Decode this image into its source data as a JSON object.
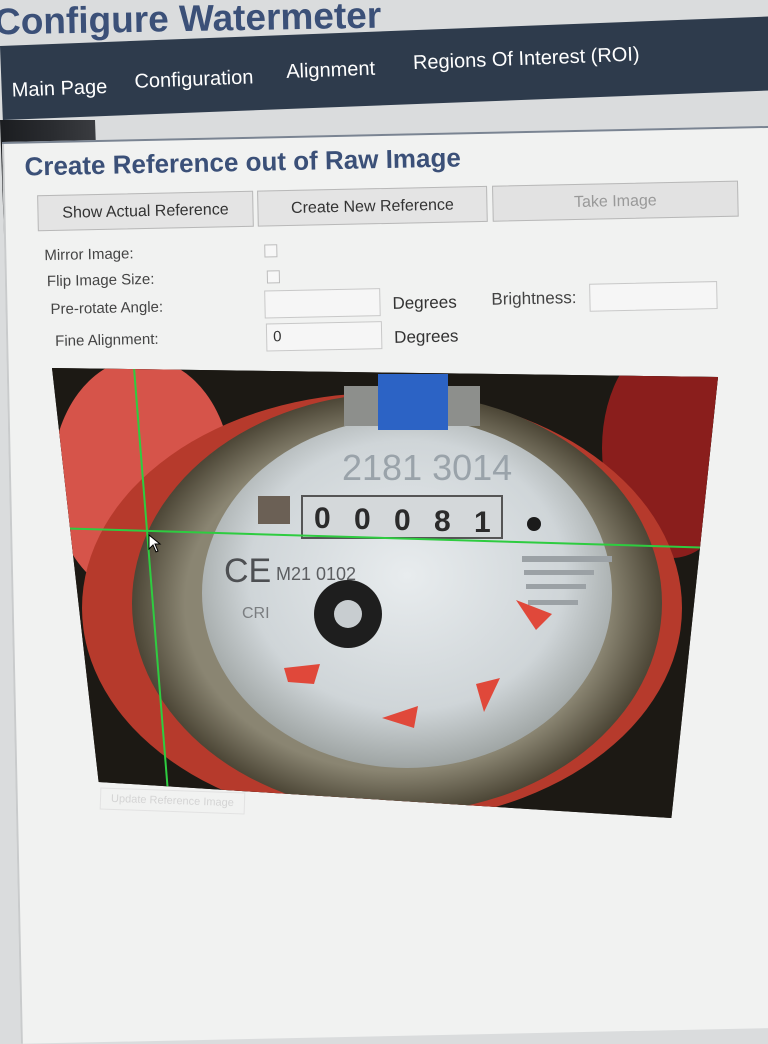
{
  "app": {
    "title": "Configure Watermeter"
  },
  "nav": {
    "items": [
      {
        "label": "Main Page"
      },
      {
        "label": "Configuration"
      },
      {
        "label": "Alignment"
      },
      {
        "label": "Regions Of Interest (ROI)"
      }
    ]
  },
  "section": {
    "heading": "Create Reference out of Raw Image"
  },
  "buttons": {
    "show_actual": "Show Actual Reference",
    "create_new": "Create New Reference",
    "take_image": "Take Image",
    "update_reference": "Update Reference Image"
  },
  "settings": {
    "mirror_label": "Mirror Image:",
    "flip_label": "Flip Image Size:",
    "prerotate_label": "Pre-rotate Angle:",
    "prerotate_value": "",
    "prerotate_unit": "Degrees",
    "fine_label": "Fine Alignment:",
    "fine_value": "0",
    "fine_unit": "Degrees",
    "brightness_label": "Brightness:",
    "brightness_value": ""
  },
  "meter": {
    "serial": "2181 3014",
    "digits": [
      "0",
      "0",
      "0",
      "8",
      "1"
    ],
    "ce_mark": "CE",
    "model": "M21 0102",
    "cri": "CRI"
  },
  "colors": {
    "accent": "#3b5078",
    "navbar": "#2e3b4c",
    "grid_line": "#2ecc40",
    "meter_red": "#e0483a"
  }
}
